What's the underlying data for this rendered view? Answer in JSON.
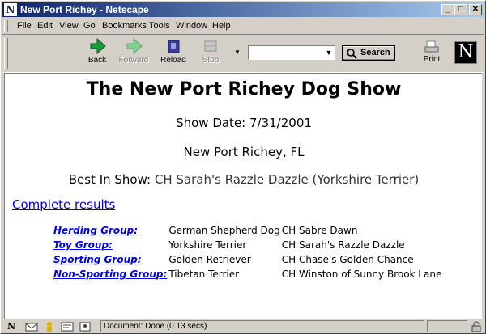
{
  "window": {
    "title": "New Port Richey - Netscape"
  },
  "menu": [
    "File",
    "Edit",
    "View",
    "Go",
    "Bookmarks",
    "Tools",
    "Window",
    "Help"
  ],
  "toolbar": {
    "back": "Back",
    "forward": "Forward",
    "reload": "Reload",
    "stop": "Stop",
    "search": "Search",
    "print": "Print",
    "url_value": ""
  },
  "page": {
    "title": "The New Port Richey Dog Show",
    "show_date": "Show Date: 7/31/2001",
    "location": "New Port Richey, FL",
    "best_in_show_label": "Best In Show:",
    "best_in_show_value": "CH Sarah's Razzle Dazzle (Yorkshire Terrier)",
    "complete_results": "Complete results",
    "groups": [
      {
        "group": "Herding Group:",
        "breed": "German Shepherd Dog",
        "winner": "CH Sabre Dawn"
      },
      {
        "group": "Toy Group:",
        "breed": "Yorkshire Terrier",
        "winner": "CH Sarah's Razzle Dazzle"
      },
      {
        "group": "Sporting Group:",
        "breed": "Golden Retriever",
        "winner": "CH Chase's Golden Chance"
      },
      {
        "group": "Non-Sporting Group:",
        "breed": "Tibetan Terrier",
        "winner": "CH Winston of Sunny Brook Lane"
      }
    ]
  },
  "status": {
    "text": "Document: Done (0.13 secs)"
  },
  "colors": {
    "link": "#0000ee",
    "titlebar_start": "#0a246a",
    "titlebar_end": "#a6caf0"
  }
}
